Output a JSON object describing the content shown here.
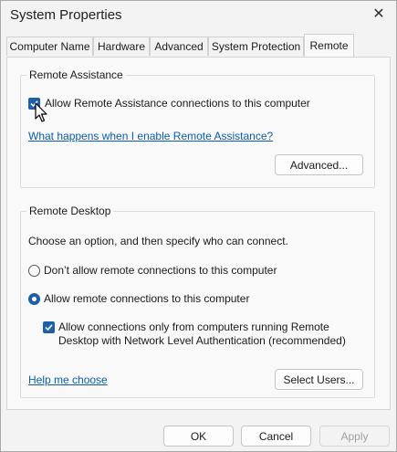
{
  "window": {
    "title": "System Properties",
    "close_glyph": "✕"
  },
  "tabs": [
    {
      "label": "Computer Name"
    },
    {
      "label": "Hardware"
    },
    {
      "label": "Advanced"
    },
    {
      "label": "System Protection"
    },
    {
      "label": "Remote",
      "active": true
    }
  ],
  "remote_assistance": {
    "legend": "Remote Assistance",
    "allow_label": "Allow Remote Assistance connections to this computer",
    "allow_checked": true,
    "help_link": "What happens when I enable Remote Assistance?",
    "advanced_button": "Advanced..."
  },
  "remote_desktop": {
    "legend": "Remote Desktop",
    "instruction": "Choose an option, and then specify who can connect.",
    "option_deny": "Don’t allow remote connections to this computer",
    "option_allow": "Allow remote connections to this computer",
    "selected": "allow",
    "nla_line1": "Allow connections only from computers running Remote",
    "nla_line2": "Desktop with Network Level Authentication (recommended)",
    "nla_checked": true,
    "help_link": "Help me choose",
    "select_users_button": "Select Users..."
  },
  "footer": {
    "ok": "OK",
    "cancel": "Cancel",
    "apply": "Apply"
  },
  "colors": {
    "accent": "#1e5fa8",
    "link": "#0b5cad"
  },
  "icons": {
    "close": "close-icon",
    "check": "check-icon",
    "cursor": "mouse-pointer-icon"
  }
}
